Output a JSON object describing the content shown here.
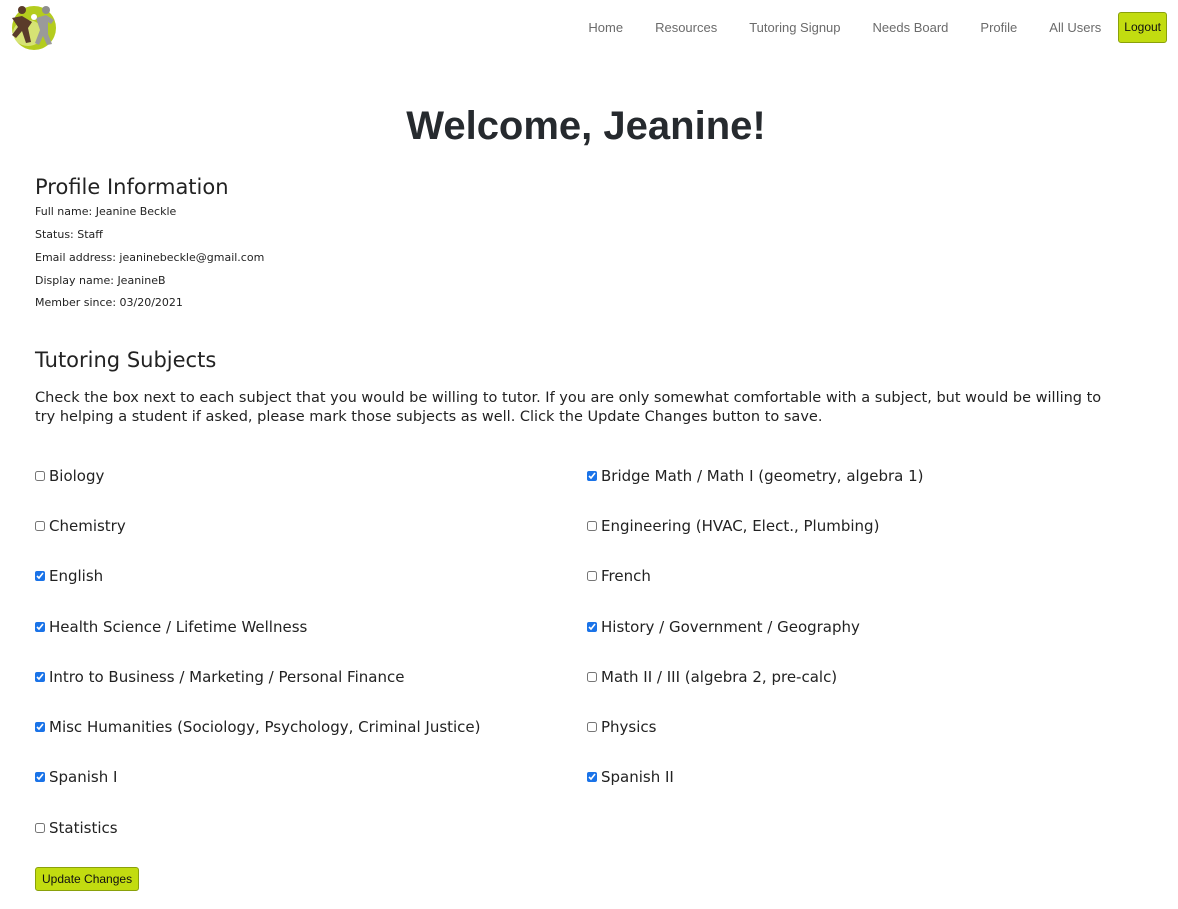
{
  "nav": {
    "links": [
      "Home",
      "Resources",
      "Tutoring Signup",
      "Needs Board",
      "Profile",
      "All Users"
    ],
    "logout_label": "Logout",
    "accent_color": "#c2dc10"
  },
  "welcome": "Welcome, Jeanine!",
  "profile": {
    "title": "Profile Information",
    "full_name": "Full name: Jeanine Beckle",
    "status": "Status: Staff",
    "email": "Email address: jeaninebeckle@gmail.com",
    "display_name": "Display name: JeanineB",
    "member_since": "Member since: 03/20/2021"
  },
  "tutoring": {
    "title": "Tutoring Subjects",
    "instructions": "Check the box next to each subject that you would be willing to tutor. If you are only somewhat comfortable with a subject, but would be willing to try helping a student if asked, please mark those subjects as well. Click the Update Changes button to save.",
    "subjects": [
      {
        "label": "Biology",
        "checked": false
      },
      {
        "label": "Bridge Math / Math I (geometry, algebra 1)",
        "checked": true
      },
      {
        "label": "Chemistry",
        "checked": false
      },
      {
        "label": "Engineering (HVAC, Elect., Plumbing)",
        "checked": false
      },
      {
        "label": "English",
        "checked": true
      },
      {
        "label": "French",
        "checked": false
      },
      {
        "label": "Health Science / Lifetime Wellness",
        "checked": true
      },
      {
        "label": "History / Government / Geography",
        "checked": true
      },
      {
        "label": "Intro to Business / Marketing / Personal Finance",
        "checked": true
      },
      {
        "label": "Math II / III (algebra 2, pre-calc)",
        "checked": false
      },
      {
        "label": "Misc Humanities (Sociology, Psychology, Criminal Justice)",
        "checked": true
      },
      {
        "label": "Physics",
        "checked": false
      },
      {
        "label": "Spanish I",
        "checked": true
      },
      {
        "label": "Spanish II",
        "checked": true
      },
      {
        "label": "Statistics",
        "checked": false
      }
    ],
    "update_label": "Update Changes"
  }
}
